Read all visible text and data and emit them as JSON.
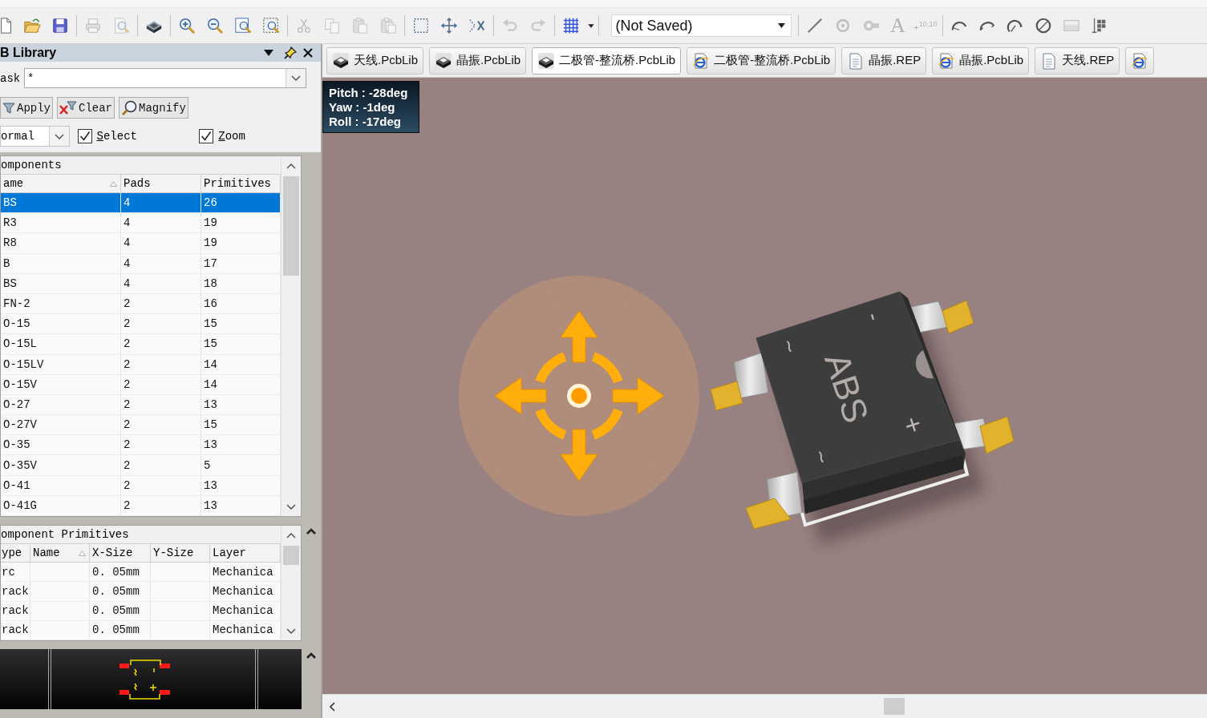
{
  "toolbar": {
    "groups": [
      [
        {
          "kind": "new",
          "disabled": false
        },
        {
          "kind": "open",
          "disabled": false
        },
        {
          "kind": "save",
          "disabled": false
        }
      ],
      [
        {
          "kind": "print",
          "disabled": true
        },
        {
          "kind": "preview",
          "disabled": true
        }
      ],
      [
        {
          "kind": "board3d",
          "disabled": false
        }
      ],
      [
        {
          "kind": "zoom_in",
          "disabled": false
        },
        {
          "kind": "zoom_out",
          "disabled": false
        },
        {
          "kind": "zoom_fit",
          "disabled": false
        },
        {
          "kind": "zoom_area",
          "disabled": false
        }
      ],
      [
        {
          "kind": "cut",
          "disabled": true
        },
        {
          "kind": "copy",
          "disabled": true
        },
        {
          "kind": "paste",
          "disabled": true
        },
        {
          "kind": "paste_special",
          "disabled": true
        }
      ],
      [
        {
          "kind": "select_rect",
          "disabled": false
        },
        {
          "kind": "move",
          "disabled": false
        },
        {
          "kind": "select_cross",
          "disabled": false
        }
      ],
      [
        {
          "kind": "undo",
          "disabled": true
        },
        {
          "kind": "redo",
          "disabled": true
        }
      ],
      [
        {
          "kind": "grid",
          "disabled": false
        },
        {
          "kind": "menu_caret",
          "disabled": false
        }
      ],
      [
        {
          "kind": "combo",
          "value": "(Not Saved)"
        }
      ],
      [
        {
          "kind": "line",
          "disabled": false
        },
        {
          "kind": "pad",
          "disabled": true
        },
        {
          "kind": "via",
          "disabled": true
        },
        {
          "kind": "text",
          "label": "A",
          "disabled": true
        },
        {
          "kind": "coordinate",
          "label": "+$^{10,10}$",
          "disabled": true
        }
      ],
      [
        {
          "kind": "arc_center",
          "disabled": false
        },
        {
          "kind": "arc_edge",
          "disabled": false
        },
        {
          "kind": "arc_any",
          "disabled": false
        },
        {
          "kind": "circle",
          "disabled": false
        },
        {
          "kind": "fill_rect",
          "disabled": false
        },
        {
          "kind": "array",
          "disabled": false
        }
      ]
    ]
  },
  "library_panel": {
    "title": "B Library",
    "mask": {
      "label": "ask",
      "value": "*"
    },
    "buttons": [
      {
        "kind": "apply",
        "label": "Apply"
      },
      {
        "kind": "clear",
        "label": "Clear"
      },
      {
        "kind": "magnify",
        "label": "Magnify"
      }
    ],
    "mode": {
      "value": "ormal"
    },
    "checkboxes": [
      {
        "label": "Select",
        "checked": true
      },
      {
        "label": "Zoom",
        "checked": true
      }
    ],
    "components": {
      "title": "omponents",
      "columns": [
        {
          "label": "ame",
          "sorted": true
        },
        {
          "label": "Pads",
          "sorted": false
        },
        {
          "label": "Primitives",
          "sorted": false
        }
      ],
      "rows": [
        {
          "cells": [
            "BS",
            "4",
            "26"
          ],
          "selected": true
        },
        {
          "cells": [
            "R3",
            "4",
            "19"
          ],
          "selected": false
        },
        {
          "cells": [
            "R8",
            "4",
            "19"
          ],
          "selected": false
        },
        {
          "cells": [
            "B",
            "4",
            "17"
          ],
          "selected": false
        },
        {
          "cells": [
            "BS",
            "4",
            "18"
          ],
          "selected": false
        },
        {
          "cells": [
            "FN-2",
            "2",
            "16"
          ],
          "selected": false
        },
        {
          "cells": [
            "O-15",
            "2",
            "15"
          ],
          "selected": false
        },
        {
          "cells": [
            "O-15L",
            "2",
            "15"
          ],
          "selected": false
        },
        {
          "cells": [
            "O-15LV",
            "2",
            "14"
          ],
          "selected": false
        },
        {
          "cells": [
            "O-15V",
            "2",
            "14"
          ],
          "selected": false
        },
        {
          "cells": [
            "O-27",
            "2",
            "13"
          ],
          "selected": false
        },
        {
          "cells": [
            "O-27V",
            "2",
            "15"
          ],
          "selected": false
        },
        {
          "cells": [
            "O-35",
            "2",
            "13"
          ],
          "selected": false
        },
        {
          "cells": [
            "O-35V",
            "2",
            "5"
          ],
          "selected": false
        },
        {
          "cells": [
            "O-41",
            "2",
            "13"
          ],
          "selected": false
        },
        {
          "cells": [
            "O-41G",
            "2",
            "13"
          ],
          "selected": false
        }
      ]
    },
    "primitives": {
      "title": "omponent Primitives",
      "columns": [
        {
          "label": "ype",
          "sorted": false
        },
        {
          "label": "Name",
          "sorted": true
        },
        {
          "label": "X-Size",
          "sorted": false
        },
        {
          "label": "Y-Size",
          "sorted": false
        },
        {
          "label": "Layer",
          "sorted": false
        }
      ],
      "rows": [
        {
          "type": "rc",
          "x_size": "0. 05mm",
          "layer": "Mechanica",
          "selected": false
        },
        {
          "type": "rack",
          "x_size": "0. 05mm",
          "layer": "Mechanica",
          "selected": false
        },
        {
          "type": "rack",
          "x_size": "0. 05mm",
          "layer": "Mechanica",
          "selected": false
        },
        {
          "type": "rack",
          "x_size": "0. 05mm",
          "layer": "Mechanica",
          "selected": false
        }
      ]
    }
  },
  "tabs": [
    {
      "label": "天线.PcbLib",
      "kind": "pcblib",
      "selected": false
    },
    {
      "label": "晶振.PcbLib",
      "kind": "pcblib",
      "selected": false
    },
    {
      "label": "二极管-整流桥.PcbLib",
      "kind": "pcblib",
      "selected": true
    },
    {
      "label": "二极管-整流桥.PcbLib",
      "kind": "web",
      "selected": false
    },
    {
      "label": "晶振.REP",
      "kind": "report",
      "selected": false
    },
    {
      "label": "晶振.PcbLib",
      "kind": "web",
      "selected": false
    },
    {
      "label": "天线.REP",
      "kind": "report",
      "selected": false
    },
    {
      "kind": "web",
      "selected": false
    }
  ],
  "view": {
    "info": [
      "Pitch : -28deg",
      "Yaw : -1deg",
      "Roll : -17deg"
    ],
    "model": {
      "marking": "ABS",
      "symbols": [
        "-",
        "~",
        "+",
        "~"
      ]
    }
  }
}
